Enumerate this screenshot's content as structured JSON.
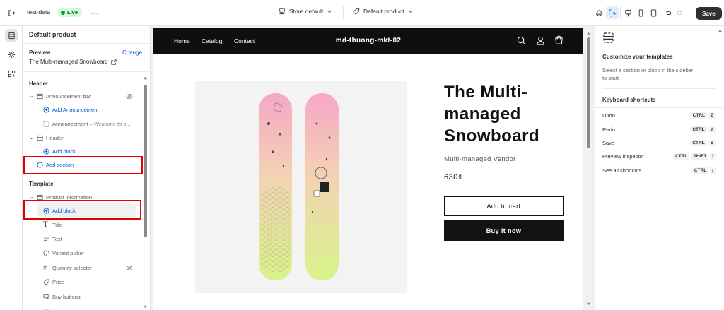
{
  "topbar": {
    "theme_name": "test-data",
    "live_label": "Live",
    "store_select": "Store default",
    "template_select": "Default product",
    "save_label": "Save"
  },
  "sidebar": {
    "title": "Default product",
    "preview_heading": "Preview",
    "change_link": "Change",
    "preview_product": "The Multi-managed Snowboard",
    "header_group": "Header",
    "template_group": "Template",
    "rows": [
      {
        "label": "Announcement bar",
        "kind": "section"
      },
      {
        "label": "Add Announcement",
        "kind": "add"
      },
      {
        "label": "Announcement",
        "suffix": "– Welcome to o...",
        "kind": "block"
      },
      {
        "label": "Header",
        "kind": "section"
      },
      {
        "label": "Add block",
        "kind": "add"
      },
      {
        "label": "Add section",
        "kind": "add"
      },
      {
        "label": "Product information",
        "kind": "section"
      },
      {
        "label": "Add block",
        "kind": "add"
      },
      {
        "label": "Title",
        "kind": "block"
      },
      {
        "label": "Text",
        "kind": "block"
      },
      {
        "label": "Variant picker",
        "kind": "block"
      },
      {
        "label": "Quantity selector",
        "kind": "block"
      },
      {
        "label": "Price",
        "kind": "block"
      },
      {
        "label": "Buy buttons",
        "kind": "block"
      }
    ]
  },
  "store": {
    "nav": [
      "Home",
      "Catalog",
      "Contact"
    ],
    "brand": "md-thuong-mkt-02",
    "product_title_lines": [
      "The Multi-",
      "managed",
      "Snowboard"
    ],
    "vendor": "Multi-managed Vendor",
    "price": "630₫",
    "add_to_cart": "Add to cart",
    "buy_now": "Buy it now"
  },
  "right_panel": {
    "heading": "Customize your templates",
    "desc_line1": "Select a section or block in the sidebar",
    "desc_line2": "to start.",
    "shortcuts_heading": "Keyboard shortcuts",
    "shortcuts": [
      {
        "label": "Undo",
        "keys": [
          "CTRL",
          "Z"
        ]
      },
      {
        "label": "Redo",
        "keys": [
          "CTRL",
          "Y"
        ]
      },
      {
        "label": "Save",
        "keys": [
          "CTRL",
          "S"
        ]
      },
      {
        "label": "Preview inspector",
        "keys": [
          "CTRL",
          "SHIFT",
          "I"
        ]
      },
      {
        "label": "See all shortcuts",
        "keys": [
          "CTRL",
          "/"
        ]
      }
    ]
  },
  "colors": {
    "accent_blue": "#005bd3",
    "highlight_red": "#e00000",
    "live_green": "#29845a",
    "store_nav_bg": "#0f0f0f"
  }
}
